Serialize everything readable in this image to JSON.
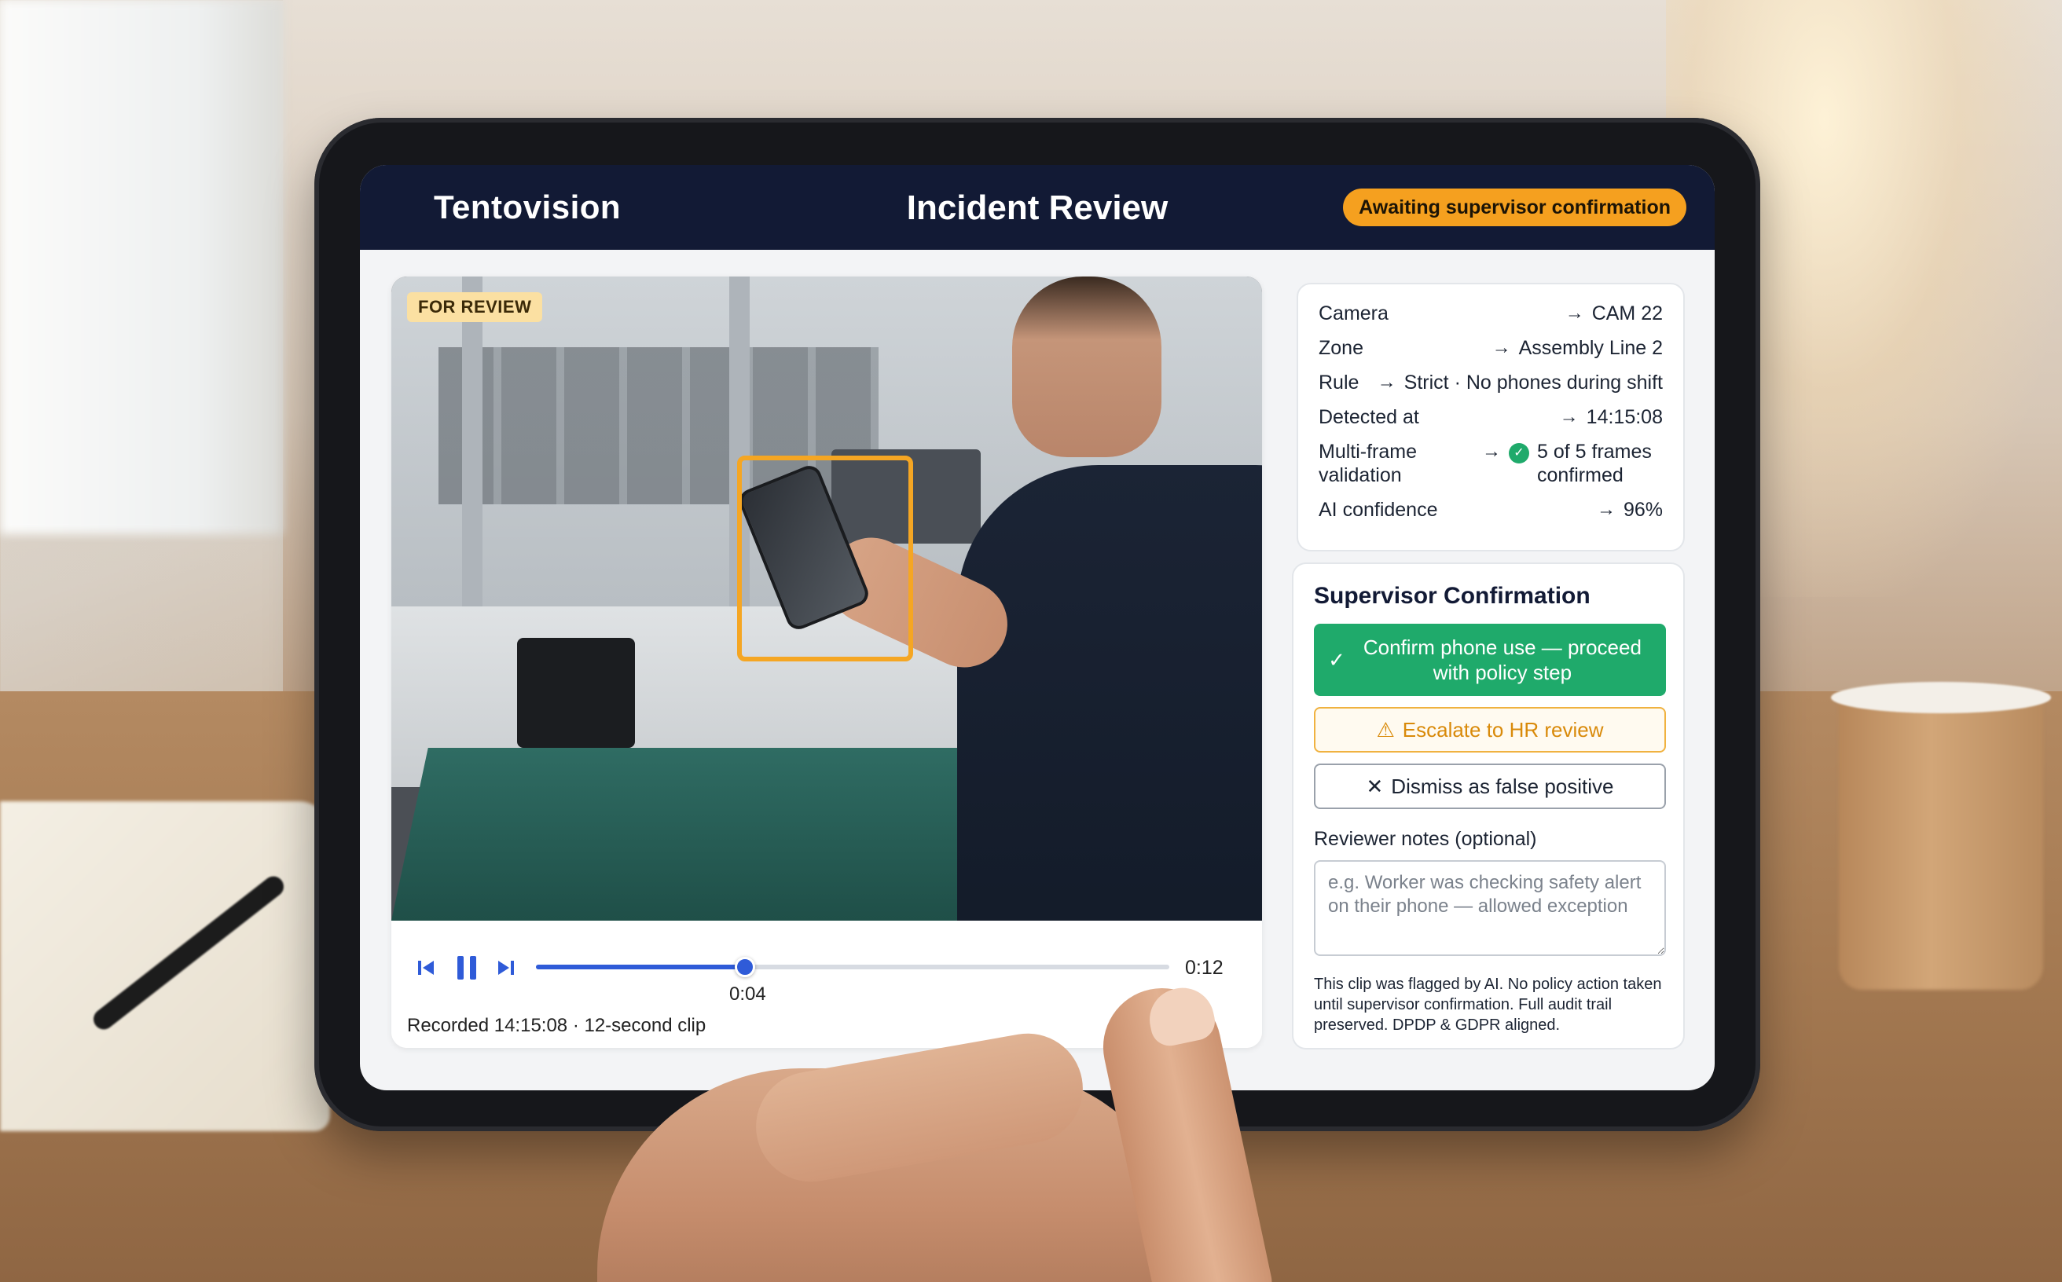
{
  "header": {
    "brand": "Tentovision",
    "title": "Incident Review",
    "status": "Awaiting supervisor confirmation"
  },
  "video": {
    "tag": "FOR REVIEW",
    "current_time": "0:04",
    "total_time": "0:12",
    "progress": 0.33,
    "recorded": "Recorded 14:15:08 · 12-second clip"
  },
  "details": [
    {
      "label": "Camera",
      "value": "CAM 22"
    },
    {
      "label": "Zone",
      "value": "Assembly Line 2"
    },
    {
      "label": "Rule",
      "value": "Strict · No phones during shift"
    },
    {
      "label": "Detected at",
      "value": "14:15:08"
    },
    {
      "label": "Multi-frame validation",
      "value": "5 of 5 frames confirmed"
    },
    {
      "label": "AI confidence",
      "value": "96%"
    }
  ],
  "confirmation": {
    "title": "Supervisor Confirmation",
    "confirm_label": "Confirm phone use — proceed with policy step",
    "escalate_label": "Escalate to HR review",
    "dismiss_label": "Dismiss as false positive",
    "notes_label": "Reviewer notes (optional)",
    "notes_placeholder": "e.g. Worker was checking safety alert on their phone — allowed exception",
    "disclaimer": "This clip was flagged by AI. No policy action taken until supervisor confirmation. Full audit trail preserved. DPDP & GDPR aligned."
  },
  "colors": {
    "header_bg": "#121a35",
    "status_pill": "#f5a01f",
    "accent_blue": "#2f5bd8",
    "confirm_green": "#1faa6b",
    "escalate_amber": "#f0b240",
    "detection_box": "#f5a623"
  },
  "icons": {
    "prev": "skip-back-icon",
    "pause": "pause-icon",
    "next": "skip-forward-icon",
    "check": "check-icon",
    "warning": "warning-icon",
    "close": "close-icon",
    "arrow": "arrow-right-icon"
  }
}
